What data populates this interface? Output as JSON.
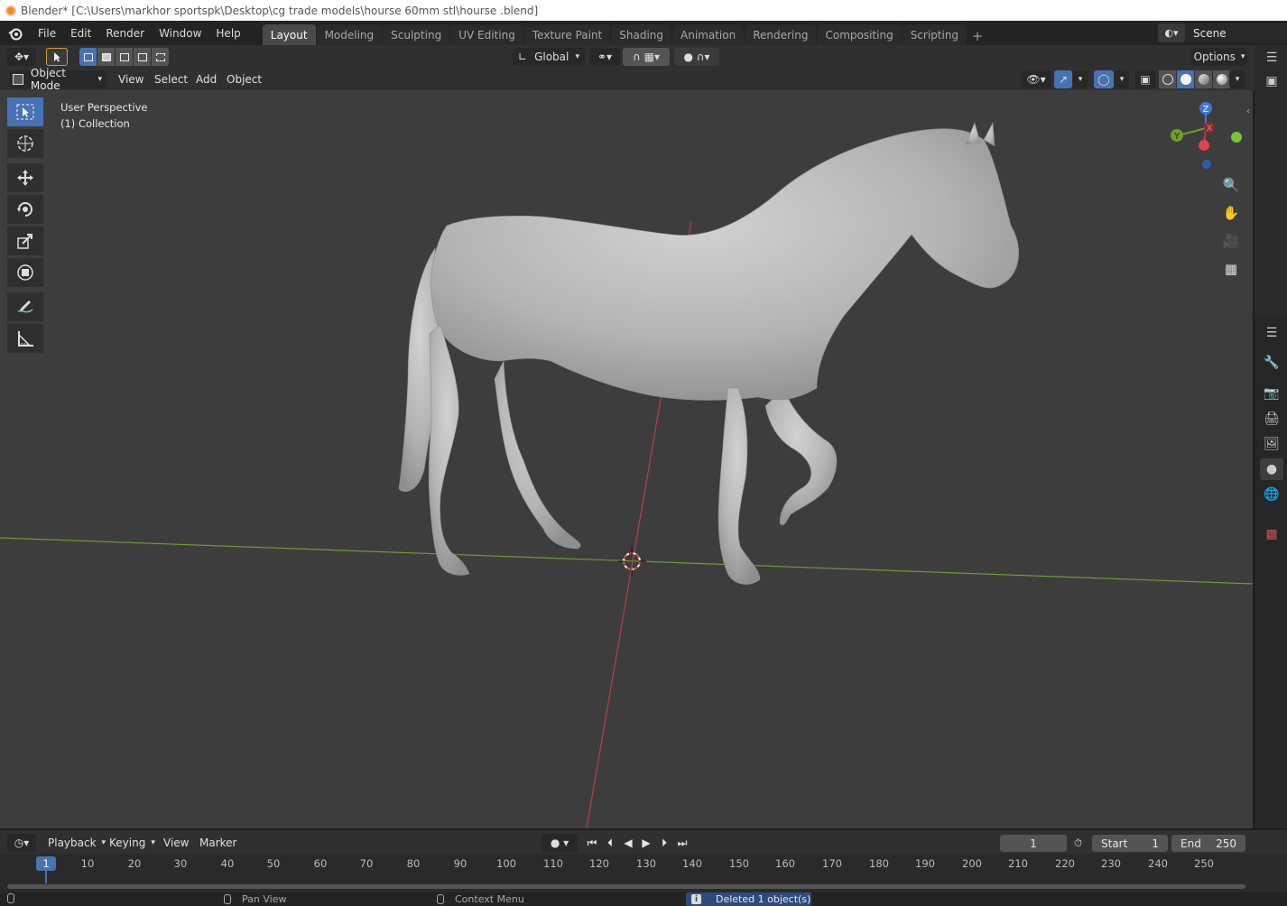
{
  "window": {
    "title": "Blender* [C:\\Users\\markhor sportspk\\Desktop\\cg trade models\\hourse 60mm stl\\hourse .blend]"
  },
  "menubar": {
    "items": [
      "File",
      "Edit",
      "Render",
      "Window",
      "Help"
    ]
  },
  "workspaces": {
    "tabs": [
      "Layout",
      "Modeling",
      "Sculpting",
      "UV Editing",
      "Texture Paint",
      "Shading",
      "Animation",
      "Rendering",
      "Compositing",
      "Scripting"
    ],
    "active": "Layout",
    "add_label": "+"
  },
  "scene": {
    "name": "Scene"
  },
  "tool_header": {
    "orientation": "Global",
    "options_label": "Options"
  },
  "viewport_header": {
    "mode": "Object Mode",
    "menus": [
      "View",
      "Select",
      "Add",
      "Object"
    ]
  },
  "viewport": {
    "perspective": "User Perspective",
    "collection": "(1) Collection"
  },
  "gizmo": {
    "x_label": "X",
    "y_label": "Y",
    "z_label": "Z"
  },
  "timeline": {
    "menus": [
      "Playback",
      "Keying",
      "View",
      "Marker"
    ],
    "current_frame": "1",
    "start_label": "Start",
    "start_value": "1",
    "end_label": "End",
    "end_value": "250",
    "ruler_ticks": [
      "10",
      "20",
      "30",
      "40",
      "50",
      "60",
      "70",
      "80",
      "90",
      "100",
      "110",
      "120",
      "130",
      "140",
      "150",
      "160",
      "170",
      "180",
      "190",
      "200",
      "210",
      "220",
      "230",
      "240",
      "250"
    ],
    "cursor_frame": "1"
  },
  "statusbar": {
    "pan_view": "Pan View",
    "context_menu": "Context Menu",
    "report": "Deleted 1 object(s)"
  },
  "colors": {
    "accent": "#4772b3",
    "x_axis": "#c0393f",
    "y_axis": "#6ea02c",
    "z_axis": "#3d77d9",
    "viewport_bg": "#3d3d3d",
    "model": "#bdbdbd"
  }
}
